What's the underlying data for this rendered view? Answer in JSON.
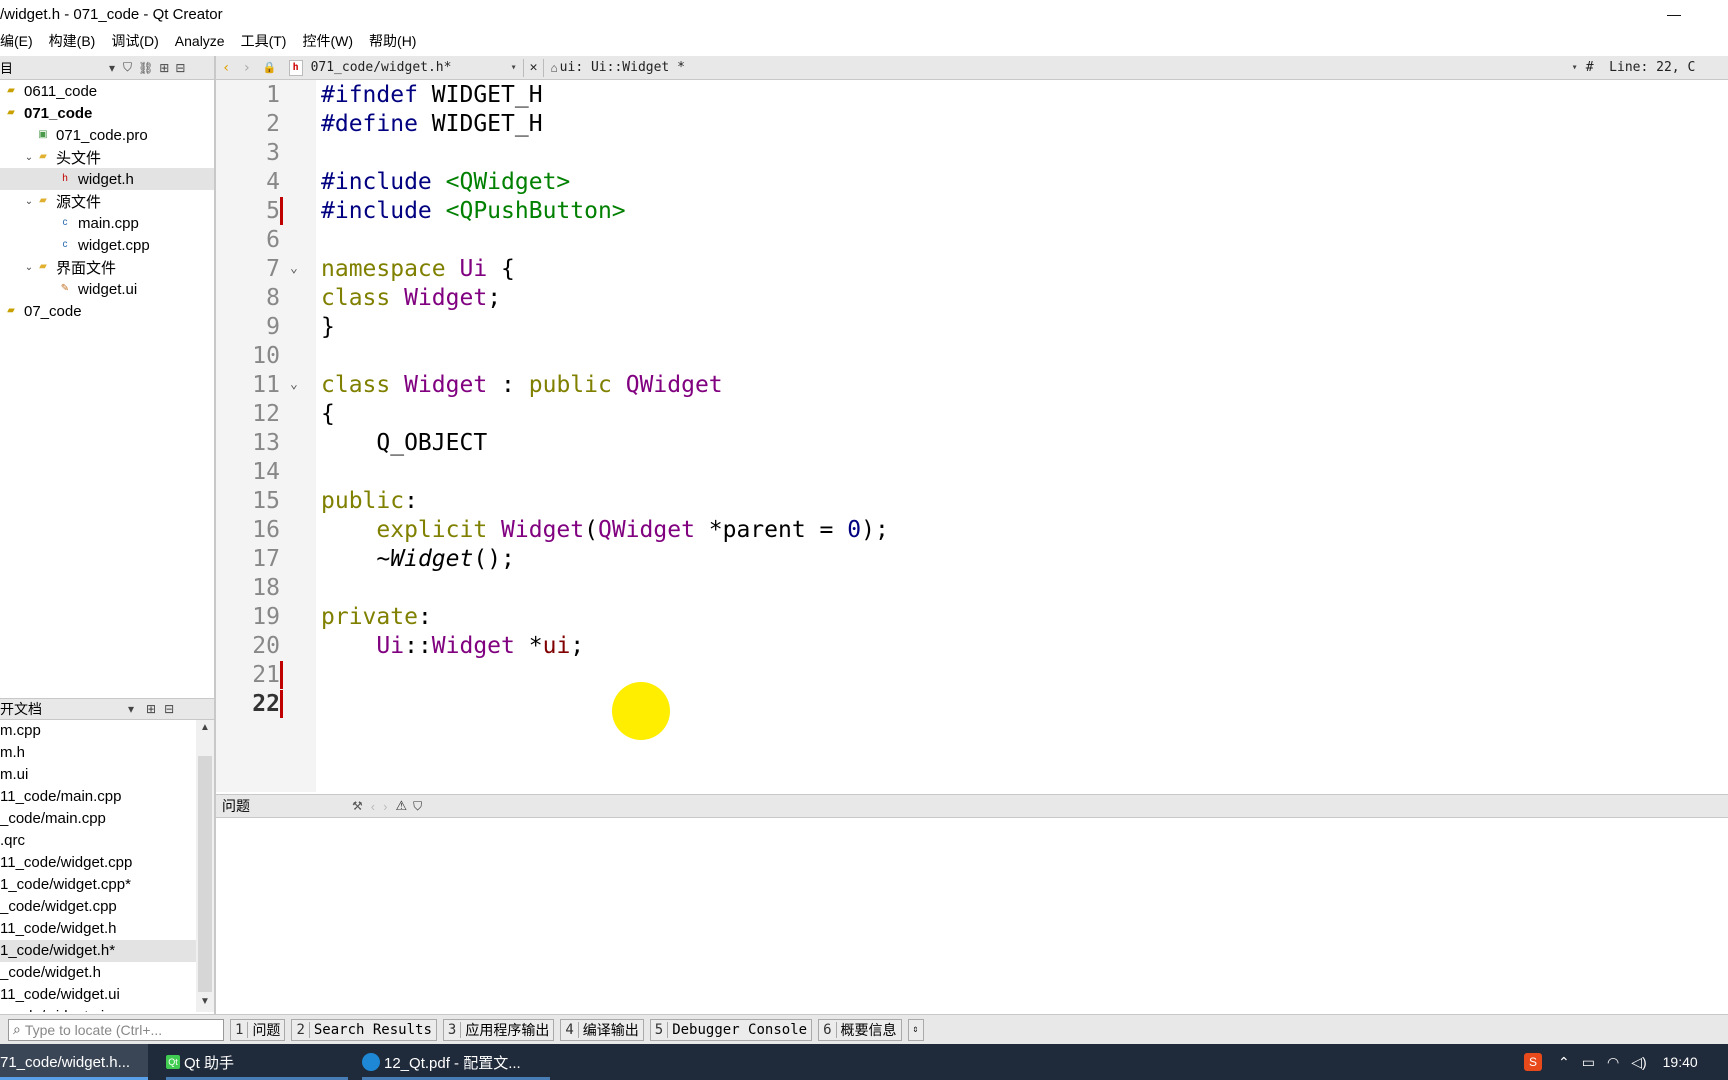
{
  "window": {
    "title": "/widget.h - 071_code - Qt Creator",
    "minimize_icon": "—",
    "close_icon": "✕"
  },
  "menu": [
    "编(E)",
    "构建(B)",
    "调试(D)",
    "Analyze",
    "工具(T)",
    "控件(W)",
    "帮助(H)"
  ],
  "project_panel": {
    "title": "目",
    "tree": [
      {
        "label": "0611_code",
        "icon": "qt-project-icon",
        "bold": false
      },
      {
        "label": "071_code",
        "icon": "qt-project-icon",
        "bold": true
      },
      {
        "label": "071_code.pro",
        "icon": "pro-file-icon",
        "bold": false
      },
      {
        "label": "头文件",
        "icon": "header-folder-icon",
        "bold": false
      },
      {
        "label": "widget.h",
        "icon": "header-file-icon",
        "bold": false
      },
      {
        "label": "源文件",
        "icon": "source-folder-icon",
        "bold": false
      },
      {
        "label": "main.cpp",
        "icon": "cpp-file-icon",
        "bold": false
      },
      {
        "label": "widget.cpp",
        "icon": "cpp-file-icon",
        "bold": false
      },
      {
        "label": "界面文件",
        "icon": "form-folder-icon",
        "bold": false
      },
      {
        "label": "widget.ui",
        "icon": "ui-file-icon",
        "bold": false
      },
      {
        "label": "07_code",
        "icon": "qt-project-icon",
        "bold": false
      }
    ]
  },
  "open_docs": {
    "title": "开文档",
    "items": [
      "m.cpp",
      "m.h",
      "m.ui",
      "11_code/main.cpp",
      "_code/main.cpp",
      ".qrc",
      "11_code/widget.cpp",
      "1_code/widget.cpp*",
      "_code/widget.cpp",
      "11_code/widget.h",
      "1_code/widget.h*",
      "_code/widget.h",
      "11_code/widget.ui",
      "_code/widget.ui"
    ]
  },
  "editor_toolbar": {
    "file_tab": "071_code/widget.h*",
    "symbol": "ui: Ui::Widget *",
    "position": "#  Line: 22, C"
  },
  "code": [
    {
      "n": "1",
      "parts": [
        [
          "pp",
          "#ifndef"
        ],
        [
          "",
          " WIDGET_H"
        ]
      ]
    },
    {
      "n": "2",
      "parts": [
        [
          "pp",
          "#define"
        ],
        [
          "",
          " WIDGET_H"
        ]
      ]
    },
    {
      "n": "3",
      "parts": []
    },
    {
      "n": "4",
      "parts": [
        [
          "pp",
          "#include"
        ],
        [
          "",
          " "
        ],
        [
          "inc",
          "<QWidget>"
        ]
      ]
    },
    {
      "n": "5",
      "parts": [
        [
          "pp",
          "#include"
        ],
        [
          "",
          " "
        ],
        [
          "inc",
          "<QPushButton>"
        ]
      ]
    },
    {
      "n": "6",
      "parts": []
    },
    {
      "n": "7",
      "parts": [
        [
          "kw",
          "namespace"
        ],
        [
          "",
          " "
        ],
        [
          "ty",
          "Ui"
        ],
        [
          "",
          " {"
        ]
      ]
    },
    {
      "n": "8",
      "parts": [
        [
          "kw",
          "class"
        ],
        [
          "",
          " "
        ],
        [
          "ty",
          "Widget"
        ],
        [
          "",
          ";"
        ]
      ]
    },
    {
      "n": "9",
      "parts": [
        [
          "",
          "}"
        ]
      ]
    },
    {
      "n": "10",
      "parts": []
    },
    {
      "n": "11",
      "parts": [
        [
          "kw",
          "class"
        ],
        [
          "",
          " "
        ],
        [
          "ty",
          "Widget"
        ],
        [
          "",
          " : "
        ],
        [
          "kw",
          "public"
        ],
        [
          "",
          " "
        ],
        [
          "ty",
          "QWidget"
        ]
      ]
    },
    {
      "n": "12",
      "parts": [
        [
          "",
          "{"
        ]
      ]
    },
    {
      "n": "13",
      "parts": [
        [
          "",
          "    Q_OBJECT"
        ]
      ]
    },
    {
      "n": "14",
      "parts": []
    },
    {
      "n": "15",
      "parts": [
        [
          "kw",
          "public"
        ],
        [
          "",
          ":"
        ]
      ]
    },
    {
      "n": "16",
      "parts": [
        [
          "",
          "    "
        ],
        [
          "kw",
          "explicit"
        ],
        [
          "",
          " "
        ],
        [
          "ty",
          "Widget"
        ],
        [
          "",
          "("
        ],
        [
          "ty",
          "QWidget"
        ],
        [
          "",
          " *parent = "
        ],
        [
          "num",
          "0"
        ],
        [
          "",
          ");"
        ]
      ]
    },
    {
      "n": "17",
      "parts": [
        [
          "",
          "    ~"
        ],
        [
          "it",
          "Widget"
        ],
        [
          "",
          "();"
        ]
      ]
    },
    {
      "n": "18",
      "parts": []
    },
    {
      "n": "19",
      "parts": [
        [
          "kw",
          "private"
        ],
        [
          "",
          ":"
        ]
      ]
    },
    {
      "n": "20",
      "parts": [
        [
          "",
          "    "
        ],
        [
          "ty",
          "Ui"
        ],
        [
          "",
          "::"
        ],
        [
          "ty",
          "Widget"
        ],
        [
          "",
          " *"
        ],
        [
          "mem",
          "ui"
        ],
        [
          "",
          ";"
        ]
      ]
    },
    {
      "n": "21",
      "parts": []
    },
    {
      "n": "22",
      "parts": []
    }
  ],
  "issues_panel": {
    "title": "问题"
  },
  "status": {
    "locate_placeholder": "Type to locate (Ctrl+...",
    "tabs": [
      {
        "n": "1",
        "label": "问题"
      },
      {
        "n": "2",
        "label": "Search Results"
      },
      {
        "n": "3",
        "label": "应用程序输出"
      },
      {
        "n": "4",
        "label": "编译输出"
      },
      {
        "n": "5",
        "label": "Debugger Console"
      },
      {
        "n": "6",
        "label": "概要信息"
      }
    ]
  },
  "taskbar": {
    "items": [
      "71_code/widget.h...",
      "Qt 助手",
      "12_Qt.pdf - 配置文..."
    ],
    "time": "19:40"
  },
  "colors": {
    "preprocessor": "#000080",
    "keyword": "#808000",
    "type": "#800080",
    "include": "#008000",
    "highlight_dot": "#ffee00",
    "change_marker": "#c00000"
  }
}
